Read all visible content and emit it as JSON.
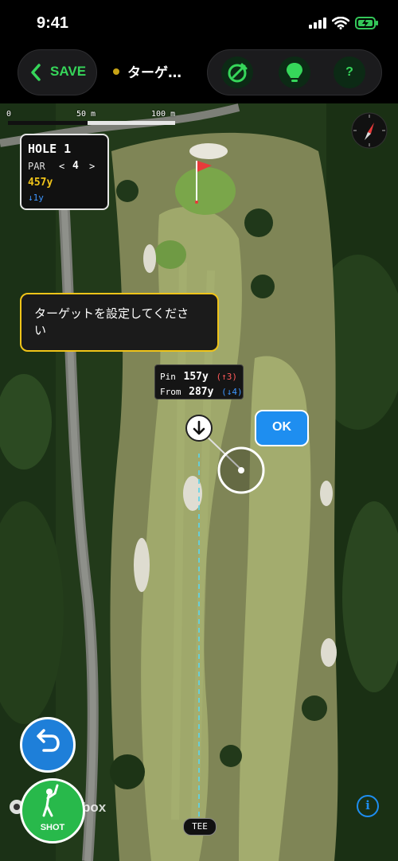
{
  "status_bar": {
    "time": "9:41"
  },
  "header": {
    "save_label": "SAVE",
    "mode_title": "ターゲ…",
    "tools": [
      "target-edit-icon",
      "lightbulb-icon",
      "help-icon"
    ],
    "help_label": "?"
  },
  "map": {
    "scale": {
      "labels": [
        "0",
        "50 m",
        "100 m"
      ]
    },
    "hole_card": {
      "title": "HOLE 1",
      "par_label": "PAR",
      "par_prev": "<",
      "par_value": "4",
      "par_next": ">",
      "distance": "457y",
      "elevation": "↓1y"
    },
    "instruction": "ターゲットを設定してください",
    "distances": {
      "pin_label": "Pin",
      "pin_value": "157y",
      "pin_delta": "(↑3)",
      "from_label": "From",
      "from_value": "287y",
      "from_delta": "(↓4)"
    },
    "ok_label": "OK",
    "shot_label": "SHOT",
    "attribution": "mapbox",
    "tee_label": "TEE"
  },
  "colors": {
    "accent_green": "#36d65a",
    "highlight_yellow": "#f0c419",
    "action_blue": "#1e8ef0",
    "delta_up_red": "#ff5a5a"
  }
}
